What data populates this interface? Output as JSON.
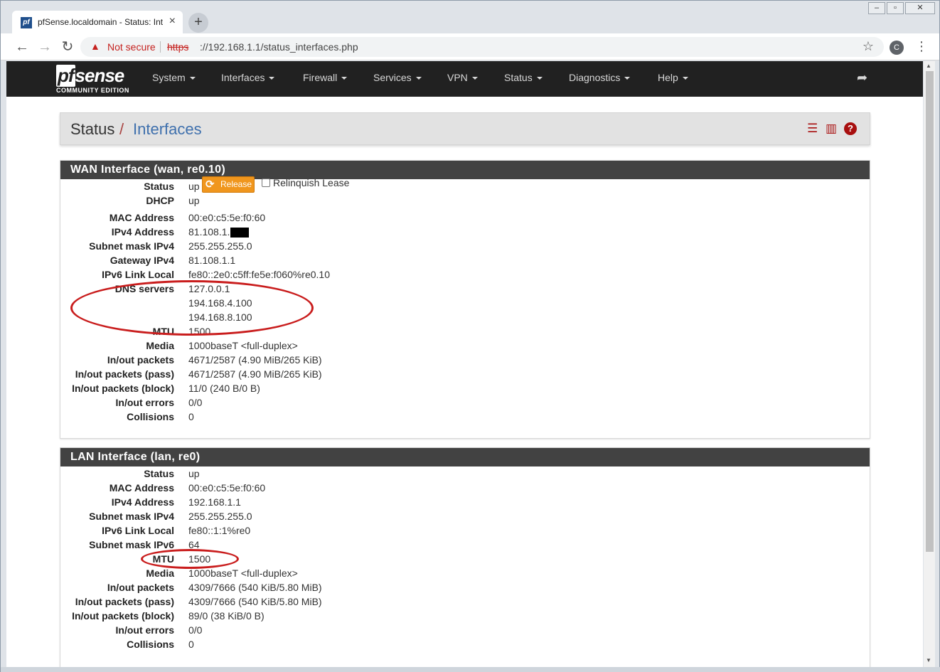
{
  "browser": {
    "tab_title": "pfSense.localdomain - Status: Int",
    "tab_favicon_text": "pf",
    "new_tab_symbol": "+",
    "security_label": "Not secure",
    "url_scheme": "https",
    "url_rest": "://192.168.1.1/status_interfaces.php",
    "profile_initial": "C"
  },
  "navbar": {
    "logo_pf": "pf",
    "logo_sense": "sense",
    "logo_sub": "COMMUNITY EDITION",
    "menus": [
      "System",
      "Interfaces",
      "Firewall",
      "Services",
      "VPN",
      "Status",
      "Diagnostics",
      "Help"
    ]
  },
  "breadcrumb": {
    "section": "Status",
    "separator": "/",
    "page": "Interfaces"
  },
  "wan": {
    "heading": "WAN Interface (wan, re0.10)",
    "release_label": "Release",
    "relinquish_label": "Relinquish Lease",
    "rows": [
      {
        "label": "Status",
        "value": "up"
      },
      {
        "label": "DHCP",
        "value": "up"
      },
      {
        "label": "MAC Address",
        "value": "00:e0:c5:5e:f0:60"
      },
      {
        "label": "IPv4 Address",
        "value": "81.108.1."
      },
      {
        "label": "Subnet mask IPv4",
        "value": "255.255.255.0"
      },
      {
        "label": "Gateway IPv4",
        "value": "81.108.1.1"
      },
      {
        "label": "IPv6 Link Local",
        "value": "fe80::2e0:c5ff:fe5e:f060%re0.10"
      },
      {
        "label": "DNS servers",
        "value": "127.0.0.1"
      },
      {
        "label": "",
        "value": "194.168.4.100"
      },
      {
        "label": "",
        "value": "194.168.8.100"
      },
      {
        "label": "MTU",
        "value": "1500"
      },
      {
        "label": "Media",
        "value": "1000baseT <full-duplex>"
      },
      {
        "label": "In/out packets",
        "value": "4671/2587 (4.90 MiB/265 KiB)"
      },
      {
        "label": "In/out packets (pass)",
        "value": "4671/2587 (4.90 MiB/265 KiB)"
      },
      {
        "label": "In/out packets (block)",
        "value": "11/0 (240 B/0 B)"
      },
      {
        "label": "In/out errors",
        "value": "0/0"
      },
      {
        "label": "Collisions",
        "value": "0"
      }
    ]
  },
  "lan": {
    "heading": "LAN Interface (lan, re0)",
    "rows": [
      {
        "label": "Status",
        "value": "up"
      },
      {
        "label": "MAC Address",
        "value": "00:e0:c5:5e:f0:60"
      },
      {
        "label": "IPv4 Address",
        "value": "192.168.1.1"
      },
      {
        "label": "Subnet mask IPv4",
        "value": "255.255.255.0"
      },
      {
        "label": "IPv6 Link Local",
        "value": "fe80::1:1%re0"
      },
      {
        "label": "Subnet mask IPv6",
        "value": "64"
      },
      {
        "label": "MTU",
        "value": "1500"
      },
      {
        "label": "Media",
        "value": "1000baseT <full-duplex>"
      },
      {
        "label": "In/out packets",
        "value": "4309/7666 (540 KiB/5.80 MiB)"
      },
      {
        "label": "In/out packets (pass)",
        "value": "4309/7666 (540 KiB/5.80 MiB)"
      },
      {
        "label": "In/out packets (block)",
        "value": "89/0 (38 KiB/0 B)"
      },
      {
        "label": "In/out errors",
        "value": "0/0"
      },
      {
        "label": "Collisions",
        "value": "0"
      }
    ]
  },
  "colors": {
    "navbar": "#212121",
    "breadcrumb_link": "#3f70ad",
    "panel_heading": "#424242",
    "release_button": "#f0961d",
    "annotation": "#c91d1d",
    "icon_red": "#a80f0f"
  },
  "icons": [
    "warning-icon",
    "star-icon",
    "logout-icon",
    "sliders-icon",
    "bar-chart-icon",
    "help-icon",
    "refresh-icon"
  ]
}
